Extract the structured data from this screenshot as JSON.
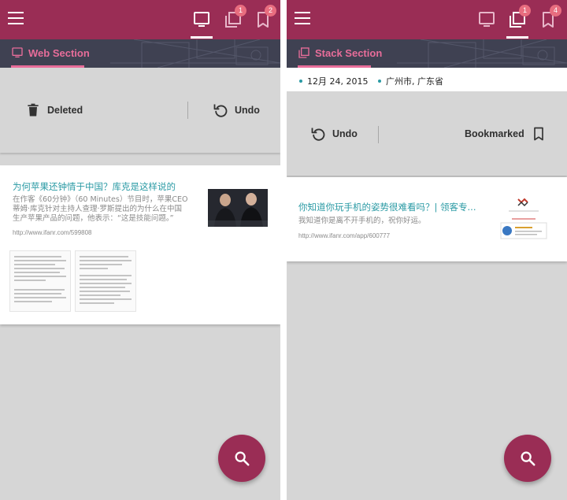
{
  "colors": {
    "primary": "#9a2d55",
    "accent": "#e86d9a",
    "link": "#2a9aa4",
    "badge": "#e86d7f"
  },
  "left": {
    "toolbar": {
      "badge_stack": "1",
      "badge_bookmark": "2"
    },
    "section": {
      "title": "Web Section"
    },
    "undo_bar": {
      "deleted": "Deleted",
      "undo": "Undo"
    },
    "article": {
      "title": "为何苹果还钟情于中国？库克是这样说的",
      "desc_lines": [
        "在作客《60分钟》（60 Minutes）节目时，苹果CEO",
        "蒂姆·库克针对主持人查理·罗斯提出的为什么在中国",
        "生产苹果产品的问题，他表示：“这是技能问题。”"
      ],
      "url": "http://www.ifanr.com/599808"
    }
  },
  "right": {
    "toolbar": {
      "badge_stack": "1",
      "badge_bookmark": "4"
    },
    "section": {
      "title": "Stack Section"
    },
    "meta": {
      "date": "12月 24, 2015",
      "location": "广州市, 广东省"
    },
    "undo_bar": {
      "undo": "Undo",
      "bookmarked": "Bookmarked"
    },
    "article": {
      "title": "你知道你玩手机的姿势很难看吗？| 领客专...",
      "desc": "我知道你是离不开手机的，祝你好运。",
      "url": "http://www.ifanr.com/app/600777"
    }
  }
}
